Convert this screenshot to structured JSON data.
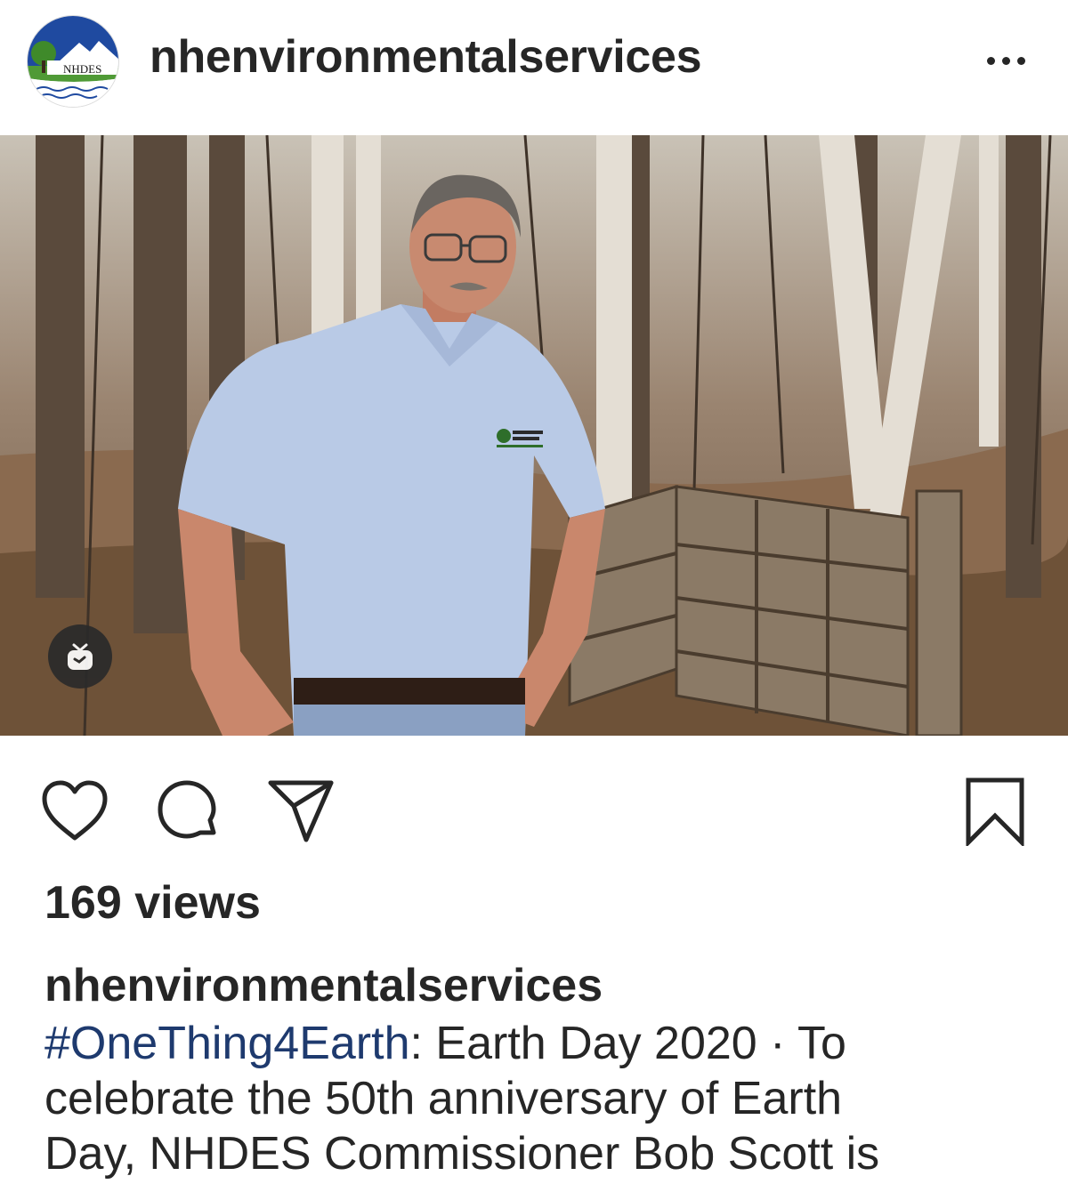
{
  "header": {
    "username": "nhenvironmentalservices",
    "avatar_label": "NHDES",
    "more_icon": "more-horizontal-icon"
  },
  "media": {
    "type_badge_icon": "igtv-icon"
  },
  "actions": {
    "like_icon": "heart-icon",
    "comment_icon": "comment-icon",
    "share_icon": "paper-plane-icon",
    "save_icon": "bookmark-icon"
  },
  "stats": {
    "views": "169 views"
  },
  "caption": {
    "username": "nhenvironmentalservices",
    "hashtag": "#OneThing4Earth",
    "text_line1": ": Earth Day 2020 · To",
    "text_line2": "celebrate the 50th anniversary of Earth",
    "text_line3": "Day, NHDES Commissioner Bob Scott is"
  },
  "colors": {
    "text": "#262626",
    "hashtag": "#1e3a6e",
    "background": "#ffffff"
  }
}
